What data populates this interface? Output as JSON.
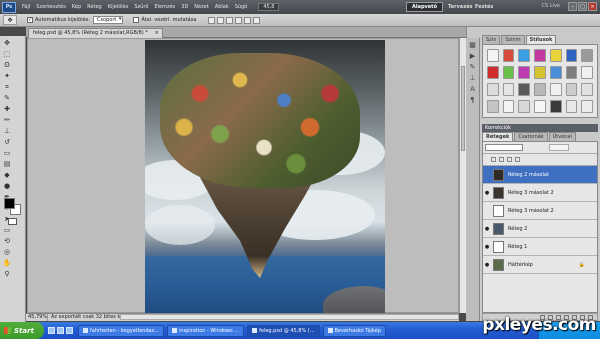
{
  "app": {
    "logo": "Ps"
  },
  "menu": {
    "items": [
      "Fájl",
      "Szerkesztés",
      "Kép",
      "Réteg",
      "Kijelölés",
      "Szűrő",
      "Elemzés",
      "3D",
      "Nézet",
      "Ablak",
      "Súgó"
    ],
    "zoom": "45,8",
    "workspaces": [
      "Alapvető",
      "Tervezés",
      "Festés"
    ],
    "cs_live": "CS Live"
  },
  "options": {
    "auto_select_label": "Automatikus kijelölés:",
    "auto_select_value": "Csoport",
    "transform_label": "Átal. vezérl. mutatása"
  },
  "document": {
    "tab_title": "feleg.psd @ 45,8% (Réteg 2 másolat,RGB/8) *"
  },
  "status": {
    "zoom": "45,79%",
    "info": "Az exportált csak 32 bites környez..."
  },
  "panels": {
    "top_tabs": [
      "Szín",
      "Színm",
      "Stílusok"
    ],
    "active_top_tab": "Stílusok",
    "mini_label": "Korrekciók",
    "layer_tabs": [
      "Rétegek",
      "Csatornák",
      "Útvonal"
    ],
    "active_layer_tab": "Rétegek"
  },
  "style_colors": [
    "#f4f4f4",
    "#d64a3c",
    "#3aa0e3",
    "#c23a9d",
    "#e9d23a",
    "#2d64c2",
    "#9a9a9a",
    "#cf2d2d",
    "#6bc04a",
    "#bd3ab0",
    "#d6c432",
    "#4a8ed6",
    "#7d7d7d",
    "#f0f0f0",
    "#dcdcdc",
    "#e6e6e6",
    "#5b5b5b",
    "#b8b8b8",
    "#f2f2f2",
    "#cccccc",
    "#e0e0e0",
    "#c4c4c4",
    "#f4f4f4",
    "#d8d8d8",
    "#f6f6f6",
    "#3a3a3a",
    "#e8e8e8",
    "#ececec"
  ],
  "layers": [
    {
      "name": "Réteg 2 másolat",
      "eye": "",
      "selected": true,
      "thumb": "#2f2b25",
      "lock": false
    },
    {
      "name": "Réteg 3 másolat 2",
      "eye": "●",
      "selected": false,
      "thumb": "#3b3530",
      "lock": false
    },
    {
      "name": "Réteg 3 másolat 2",
      "eye": "",
      "selected": false,
      "thumb": "#ffffff",
      "lock": false
    },
    {
      "name": "Réteg 2",
      "eye": "●",
      "selected": false,
      "thumb": "#4a5a6b",
      "lock": false
    },
    {
      "name": "Réteg 1",
      "eye": "●",
      "selected": false,
      "thumb": "#ffffff",
      "lock": false
    },
    {
      "name": "Háttérkép",
      "eye": "●",
      "selected": false,
      "thumb": "#5c6b4a",
      "lock": true
    }
  ],
  "taskbar": {
    "start": "Start",
    "tasks": [
      "fahrheiten - kegyetlendaz...",
      "inspiration - Windows ...",
      "feleg.psd @ 45,8% (...",
      "Bevérhaskó Tájkép"
    ],
    "active": 2
  },
  "watermark": "pxleyes.com"
}
